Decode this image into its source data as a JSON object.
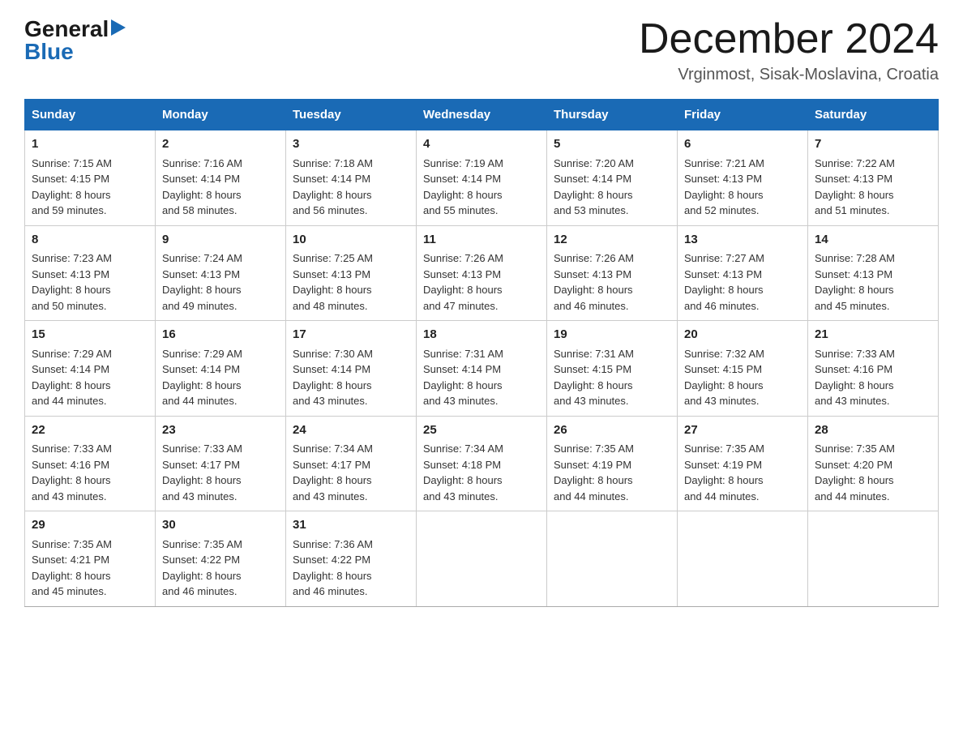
{
  "header": {
    "logo_general": "General",
    "logo_blue": "Blue",
    "title": "December 2024",
    "location": "Vrginmost, Sisak-Moslavina, Croatia"
  },
  "columns": [
    "Sunday",
    "Monday",
    "Tuesday",
    "Wednesday",
    "Thursday",
    "Friday",
    "Saturday"
  ],
  "weeks": [
    [
      {
        "day": "1",
        "sunrise": "7:15 AM",
        "sunset": "4:15 PM",
        "daylight": "8 hours and 59 minutes."
      },
      {
        "day": "2",
        "sunrise": "7:16 AM",
        "sunset": "4:14 PM",
        "daylight": "8 hours and 58 minutes."
      },
      {
        "day": "3",
        "sunrise": "7:18 AM",
        "sunset": "4:14 PM",
        "daylight": "8 hours and 56 minutes."
      },
      {
        "day": "4",
        "sunrise": "7:19 AM",
        "sunset": "4:14 PM",
        "daylight": "8 hours and 55 minutes."
      },
      {
        "day": "5",
        "sunrise": "7:20 AM",
        "sunset": "4:14 PM",
        "daylight": "8 hours and 53 minutes."
      },
      {
        "day": "6",
        "sunrise": "7:21 AM",
        "sunset": "4:13 PM",
        "daylight": "8 hours and 52 minutes."
      },
      {
        "day": "7",
        "sunrise": "7:22 AM",
        "sunset": "4:13 PM",
        "daylight": "8 hours and 51 minutes."
      }
    ],
    [
      {
        "day": "8",
        "sunrise": "7:23 AM",
        "sunset": "4:13 PM",
        "daylight": "8 hours and 50 minutes."
      },
      {
        "day": "9",
        "sunrise": "7:24 AM",
        "sunset": "4:13 PM",
        "daylight": "8 hours and 49 minutes."
      },
      {
        "day": "10",
        "sunrise": "7:25 AM",
        "sunset": "4:13 PM",
        "daylight": "8 hours and 48 minutes."
      },
      {
        "day": "11",
        "sunrise": "7:26 AM",
        "sunset": "4:13 PM",
        "daylight": "8 hours and 47 minutes."
      },
      {
        "day": "12",
        "sunrise": "7:26 AM",
        "sunset": "4:13 PM",
        "daylight": "8 hours and 46 minutes."
      },
      {
        "day": "13",
        "sunrise": "7:27 AM",
        "sunset": "4:13 PM",
        "daylight": "8 hours and 46 minutes."
      },
      {
        "day": "14",
        "sunrise": "7:28 AM",
        "sunset": "4:13 PM",
        "daylight": "8 hours and 45 minutes."
      }
    ],
    [
      {
        "day": "15",
        "sunrise": "7:29 AM",
        "sunset": "4:14 PM",
        "daylight": "8 hours and 44 minutes."
      },
      {
        "day": "16",
        "sunrise": "7:29 AM",
        "sunset": "4:14 PM",
        "daylight": "8 hours and 44 minutes."
      },
      {
        "day": "17",
        "sunrise": "7:30 AM",
        "sunset": "4:14 PM",
        "daylight": "8 hours and 43 minutes."
      },
      {
        "day": "18",
        "sunrise": "7:31 AM",
        "sunset": "4:14 PM",
        "daylight": "8 hours and 43 minutes."
      },
      {
        "day": "19",
        "sunrise": "7:31 AM",
        "sunset": "4:15 PM",
        "daylight": "8 hours and 43 minutes."
      },
      {
        "day": "20",
        "sunrise": "7:32 AM",
        "sunset": "4:15 PM",
        "daylight": "8 hours and 43 minutes."
      },
      {
        "day": "21",
        "sunrise": "7:33 AM",
        "sunset": "4:16 PM",
        "daylight": "8 hours and 43 minutes."
      }
    ],
    [
      {
        "day": "22",
        "sunrise": "7:33 AM",
        "sunset": "4:16 PM",
        "daylight": "8 hours and 43 minutes."
      },
      {
        "day": "23",
        "sunrise": "7:33 AM",
        "sunset": "4:17 PM",
        "daylight": "8 hours and 43 minutes."
      },
      {
        "day": "24",
        "sunrise": "7:34 AM",
        "sunset": "4:17 PM",
        "daylight": "8 hours and 43 minutes."
      },
      {
        "day": "25",
        "sunrise": "7:34 AM",
        "sunset": "4:18 PM",
        "daylight": "8 hours and 43 minutes."
      },
      {
        "day": "26",
        "sunrise": "7:35 AM",
        "sunset": "4:19 PM",
        "daylight": "8 hours and 44 minutes."
      },
      {
        "day": "27",
        "sunrise": "7:35 AM",
        "sunset": "4:19 PM",
        "daylight": "8 hours and 44 minutes."
      },
      {
        "day": "28",
        "sunrise": "7:35 AM",
        "sunset": "4:20 PM",
        "daylight": "8 hours and 44 minutes."
      }
    ],
    [
      {
        "day": "29",
        "sunrise": "7:35 AM",
        "sunset": "4:21 PM",
        "daylight": "8 hours and 45 minutes."
      },
      {
        "day": "30",
        "sunrise": "7:35 AM",
        "sunset": "4:22 PM",
        "daylight": "8 hours and 46 minutes."
      },
      {
        "day": "31",
        "sunrise": "7:36 AM",
        "sunset": "4:22 PM",
        "daylight": "8 hours and 46 minutes."
      },
      null,
      null,
      null,
      null
    ]
  ],
  "labels": {
    "sunrise": "Sunrise:",
    "sunset": "Sunset:",
    "daylight": "Daylight:"
  }
}
